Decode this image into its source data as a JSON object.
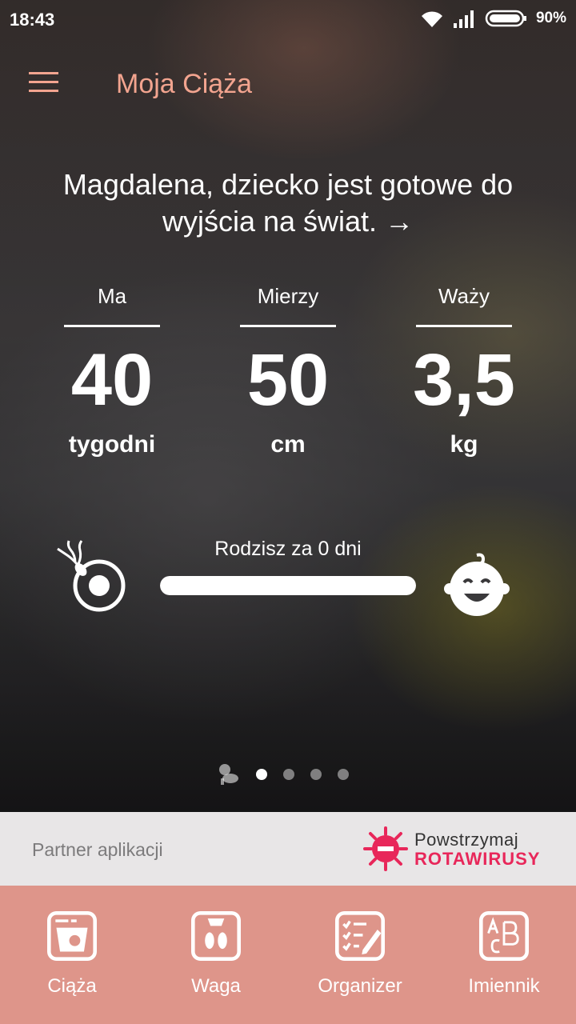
{
  "status": {
    "time": "18:43",
    "battery": "90%"
  },
  "appbar": {
    "title": "Moja Ciąża"
  },
  "headline": {
    "text": "Magdalena, dziecko jest gotowe do wyjścia na świat.",
    "arrow": "→"
  },
  "stats": [
    {
      "label": "Ma",
      "value": "40",
      "unit": "tygodni"
    },
    {
      "label": "Mierzy",
      "value": "50",
      "unit": "cm"
    },
    {
      "label": "Waży",
      "value": "3,5",
      "unit": "kg"
    }
  ],
  "progress": {
    "label": "Rodzisz za 0 dni",
    "fraction": 1.0
  },
  "pager": {
    "count": 4,
    "active": 0
  },
  "partner": {
    "label": "Partner aplikacji",
    "logo_line1": "Powstrzymaj",
    "logo_line2": "ROTAWIRUSY"
  },
  "tabs": [
    {
      "label": "Ciąża",
      "icon": "ultrasound-icon"
    },
    {
      "label": "Waga",
      "icon": "scale-icon"
    },
    {
      "label": "Organizer",
      "icon": "checklist-icon"
    },
    {
      "label": "Imiennik",
      "icon": "abc-icon"
    }
  ],
  "colors": {
    "accent": "#f2a48f",
    "tabbar": "#de958a",
    "partner_bg": "#e8e6e7",
    "logo_red": "#e8275a"
  }
}
